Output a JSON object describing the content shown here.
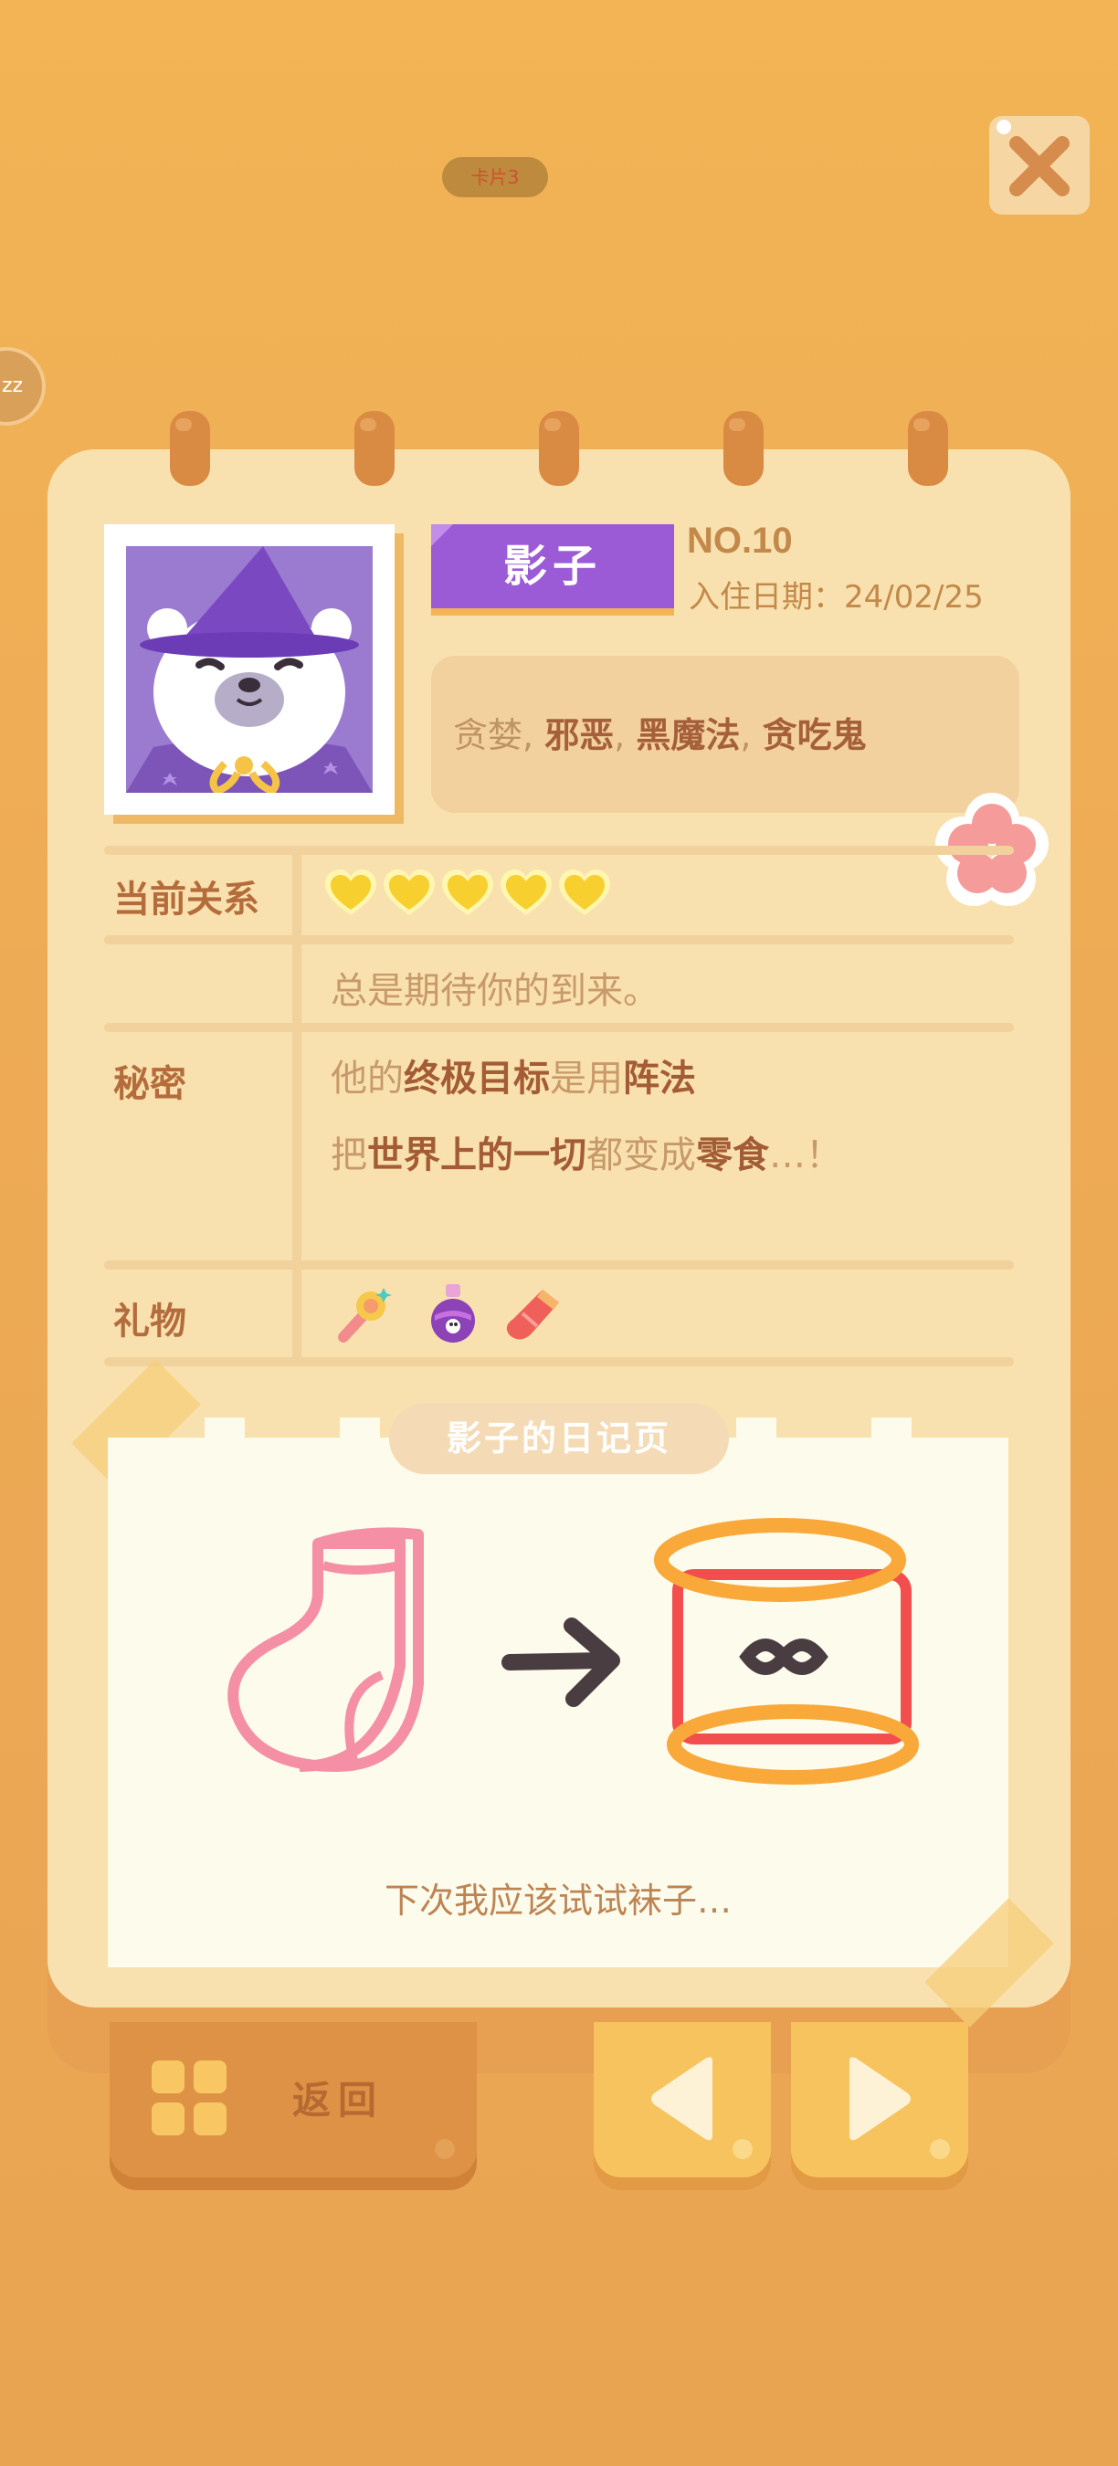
{
  "top_pill": {
    "text": "卡片3"
  },
  "sleep_badge": {
    "text": "zz"
  },
  "profile": {
    "name": "影子",
    "number": "NO.10",
    "date_label": "入住日期：",
    "date_value": "24/02/25",
    "traits": [
      {
        "text": "贪婪",
        "highlight": false
      },
      {
        "text": "邪恶",
        "highlight": true
      },
      {
        "text": "黑魔法",
        "highlight": true
      },
      {
        "text": "贪吃鬼",
        "highlight": true
      }
    ],
    "trait_separator": ", "
  },
  "relationship": {
    "label": "当前关系",
    "hearts": 5,
    "heart_color": "#f7cf2f",
    "message": "总是期待你的到来。"
  },
  "secret": {
    "label": "秘密",
    "lines": [
      [
        {
          "text": "他的",
          "strong": false
        },
        {
          "text": "终极目标",
          "strong": true
        },
        {
          "text": "是用",
          "strong": false
        },
        {
          "text": "阵法",
          "strong": true
        }
      ],
      [
        {
          "text": "把",
          "strong": false
        },
        {
          "text": "世界上的一切",
          "strong": true
        },
        {
          "text": "都变成",
          "strong": false
        },
        {
          "text": "零食",
          "strong": true
        },
        {
          "text": "…！",
          "strong": false
        }
      ]
    ]
  },
  "gifts": {
    "label": "礼物",
    "items": [
      "magic-wand-icon",
      "potion-icon",
      "sock-icon"
    ]
  },
  "diary": {
    "title": "影子的日记页",
    "caption": "下次我应该试试袜子…"
  },
  "buttons": {
    "back_label": "返回",
    "prev_icon": "left-triangle-icon",
    "next_icon": "right-triangle-icon",
    "close_icon": "close-icon"
  },
  "colors": {
    "background": "#eeab55",
    "paper": "#f8e1ae",
    "name_tag": "#9c5bd6",
    "accent_text": "#a35c35"
  }
}
